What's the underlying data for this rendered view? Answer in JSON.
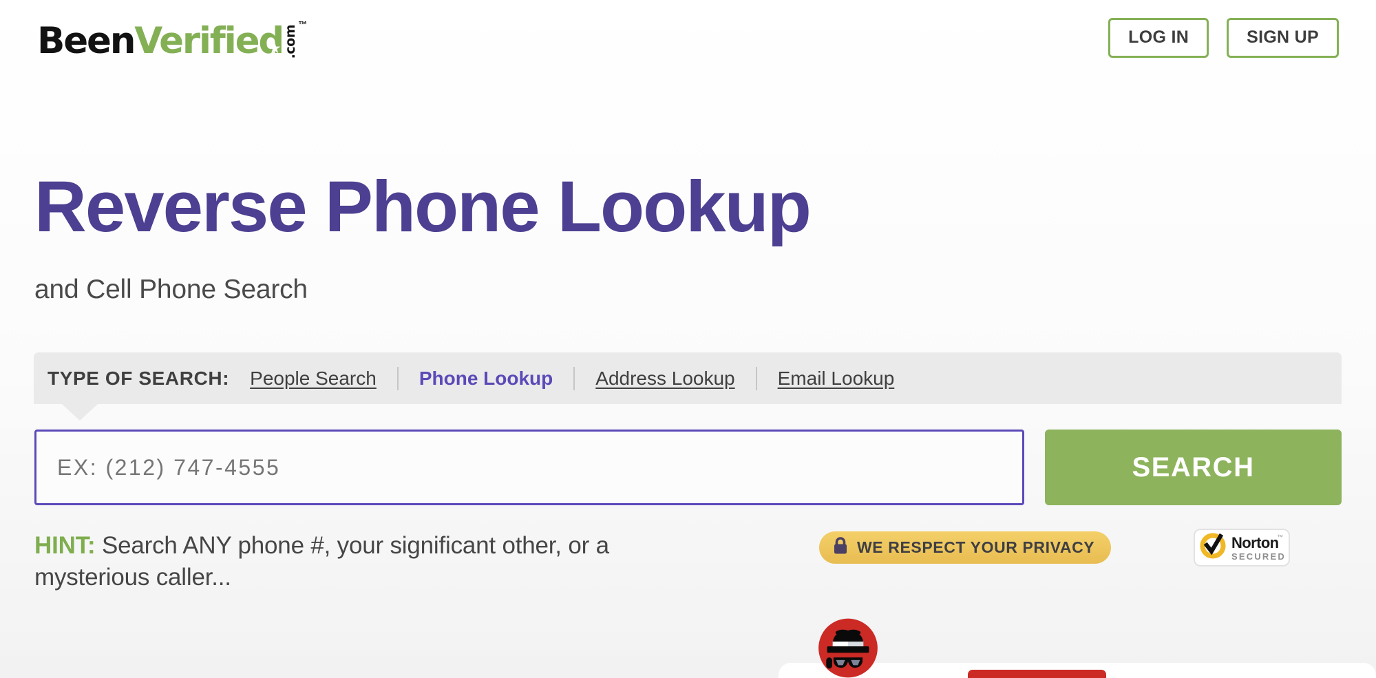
{
  "brand": {
    "logo_part1": "Been",
    "logo_part2": "Verified",
    "logo_suffix": ".com",
    "logo_trademark": "™",
    "logo_star_icon": "star-icon",
    "accent_green": "#84b055",
    "accent_purple": "#4d3f91",
    "accent_link_purple": "#5b49b8",
    "accent_gold": "#e8bd52",
    "accent_red": "#cb2a25"
  },
  "header": {
    "login_label": "LOG IN",
    "signup_label": "SIGN UP"
  },
  "hero": {
    "title": "Reverse Phone Lookup",
    "subtitle": "and Cell Phone Search"
  },
  "search": {
    "type_label": "TYPE OF SEARCH:",
    "tabs": [
      {
        "label": "People Search",
        "active": false
      },
      {
        "label": "Phone Lookup",
        "active": true
      },
      {
        "label": "Address Lookup",
        "active": false
      },
      {
        "label": "Email Lookup",
        "active": false
      }
    ],
    "input_value": "",
    "input_placeholder": "EX: (212) 747-4555",
    "button_label": "SEARCH"
  },
  "hint": {
    "key": "HINT:",
    "text": " Search ANY phone #, your significant other, or a mysterious caller..."
  },
  "badges": {
    "privacy": {
      "icon": "lock-icon",
      "label": "WE RESPECT YOUR PRIVACY"
    },
    "norton": {
      "icon": "checkmark-icon",
      "name": "Norton",
      "sub": "SECURED",
      "trademark": "™"
    }
  },
  "bottom": {
    "avatar_icon": "detective-avatar-icon"
  }
}
